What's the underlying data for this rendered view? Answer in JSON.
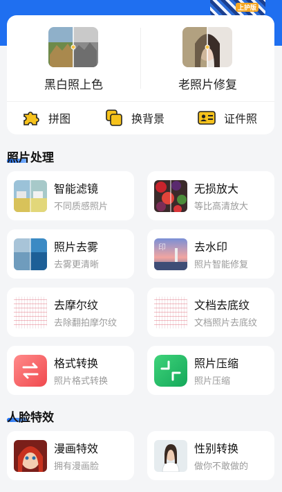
{
  "banner": {
    "badge": "上护版"
  },
  "features": [
    {
      "label": "黑白照上色"
    },
    {
      "label": "老照片修复"
    }
  ],
  "tools": [
    {
      "label": "拼图",
      "icon": "puzzle-icon"
    },
    {
      "label": "换背景",
      "icon": "layers-icon"
    },
    {
      "label": "证件照",
      "icon": "id-card-icon"
    }
  ],
  "sections": {
    "photo": "照片处理",
    "face": "人脸特效"
  },
  "photo_cards": [
    {
      "title": "智能滤镜",
      "sub": "不同质感照片"
    },
    {
      "title": "无损放大",
      "sub": "等比高清放大"
    },
    {
      "title": "照片去雾",
      "sub": "去雾更清晰"
    },
    {
      "title": "去水印",
      "sub": "照片智能修复"
    },
    {
      "title": "去摩尔纹",
      "sub": "去除翻拍摩尔纹"
    },
    {
      "title": "文档去底纹",
      "sub": "文档照片去底纹"
    },
    {
      "title": "格式转换",
      "sub": "照片格式转换"
    },
    {
      "title": "照片压缩",
      "sub": "照片压缩"
    }
  ],
  "face_cards": [
    {
      "title": "漫画特效",
      "sub": "拥有漫画脸"
    },
    {
      "title": "性别转换",
      "sub": "做你不敢做的"
    }
  ],
  "colors": {
    "accent": "#1f6ff0",
    "background": "#f4f5f7",
    "tool_yellow": "#f6c21c"
  }
}
